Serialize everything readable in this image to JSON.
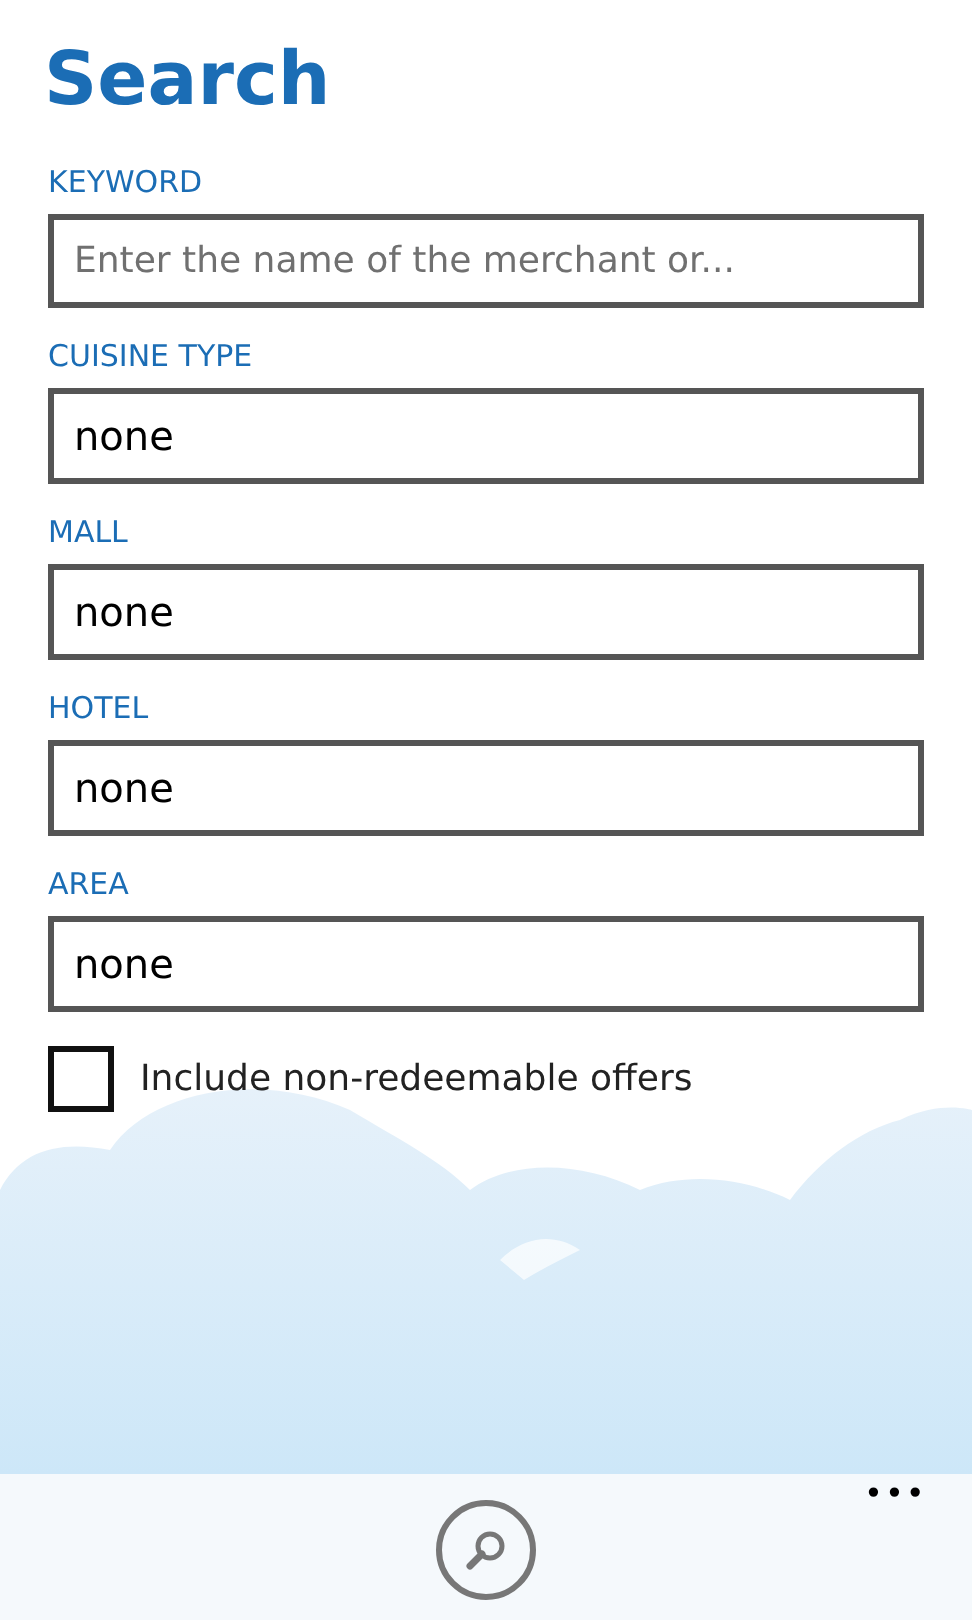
{
  "title": "Search",
  "fields": [
    {
      "label": "KEYWORD",
      "kind": "text",
      "placeholder": "Enter the name of the merchant or..."
    },
    {
      "label": "CUISINE TYPE",
      "kind": "picker",
      "value": "none"
    },
    {
      "label": "MALL",
      "kind": "picker",
      "value": "none"
    },
    {
      "label": "HOTEL",
      "kind": "picker",
      "value": "none"
    },
    {
      "label": "AREA",
      "kind": "picker",
      "value": "none"
    }
  ],
  "checkbox": {
    "label": "Include non-redeemable offers",
    "checked": false
  },
  "app_bar": {
    "more": "•••"
  }
}
